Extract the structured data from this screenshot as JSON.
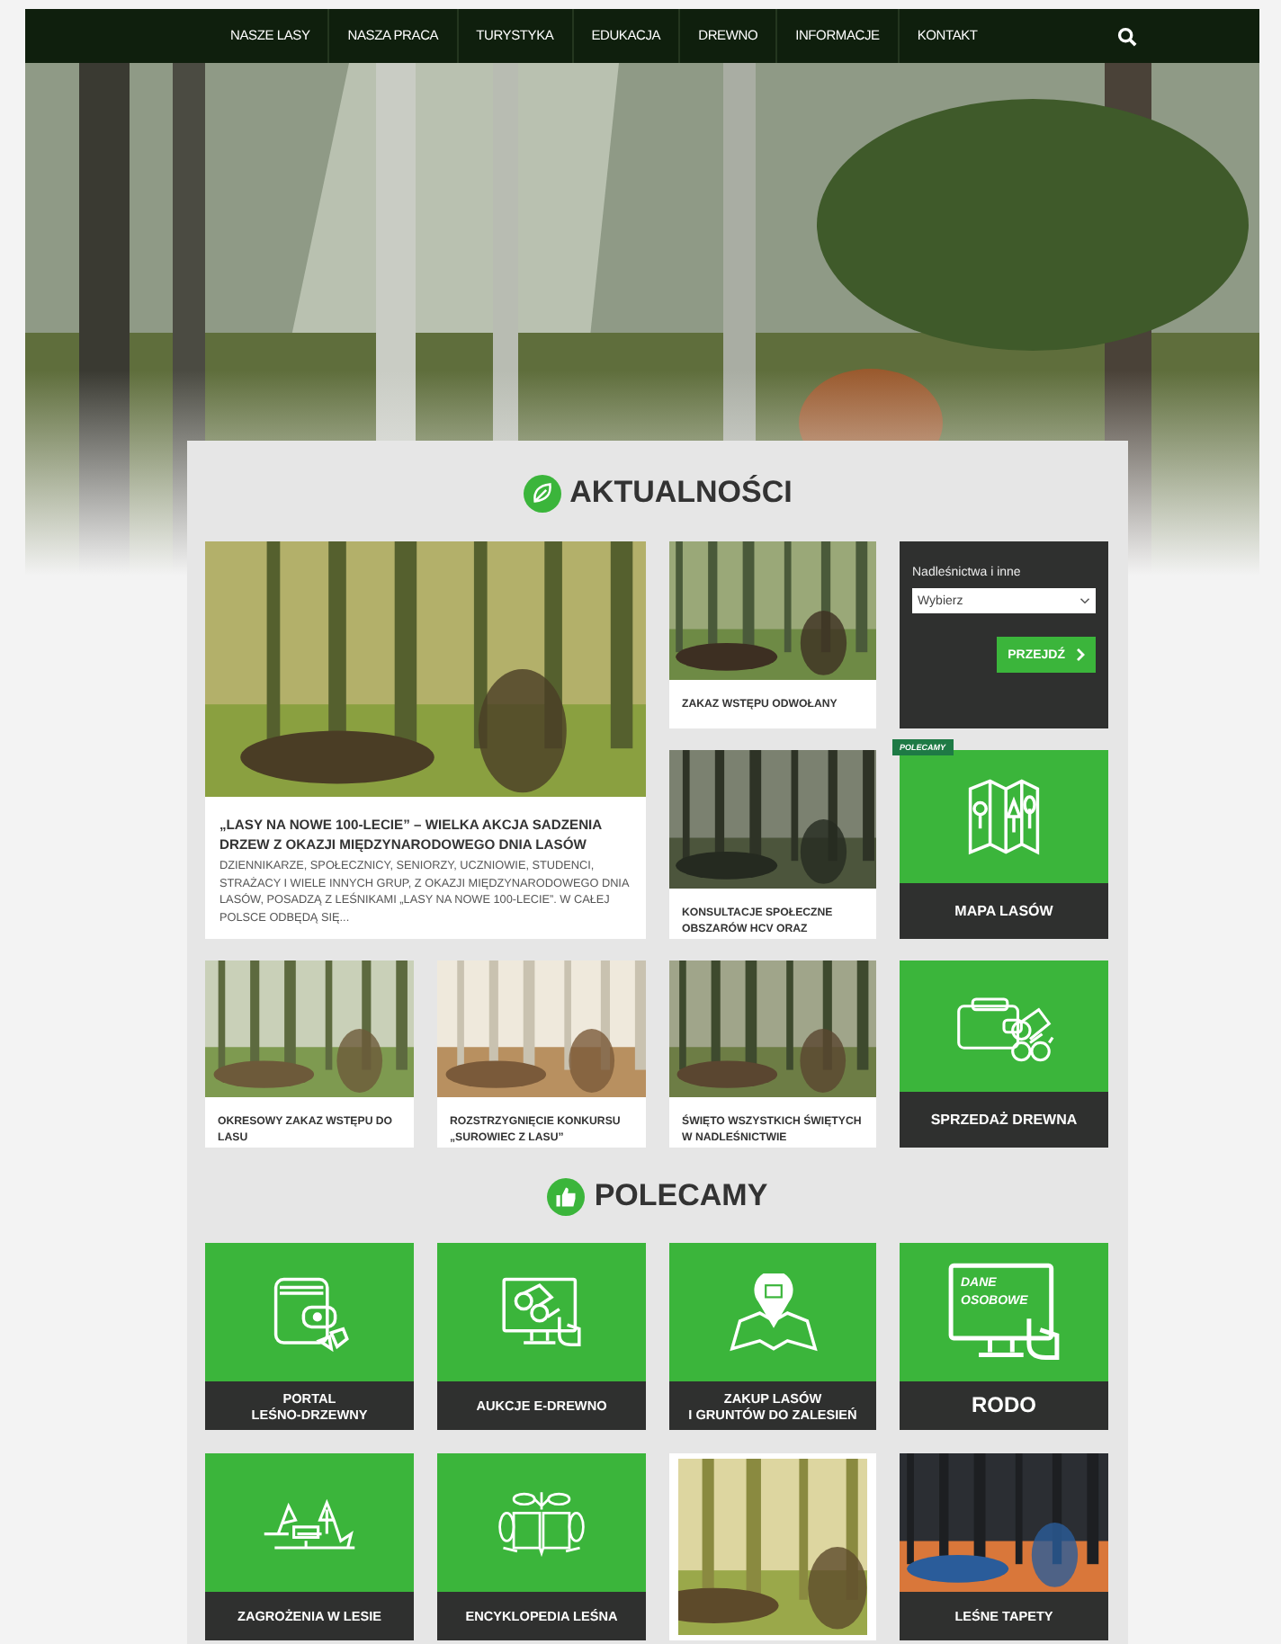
{
  "nav": {
    "items": [
      "NASZE LASY",
      "NASZA PRACA",
      "TURYSTYKA",
      "EDUKACJA",
      "DREWNO",
      "INFORMACJE",
      "KONTAKT"
    ]
  },
  "hero": {
    "kind": "picture"
  },
  "news": {
    "title": "AKTUALNOŚCI",
    "featured": {
      "title": "„LASY NA NOWE 100-LECIE” – WIELKA AKCJA SADZENIA DRZEW Z OKAZJI MIĘDZYNARODOWEGO DNIA LASÓW",
      "excerpt": "DZIENNIKARZE, SPOŁECZNICY, SENIORZY, UCZNIOWIE, STUDENCI, STRAŻACY I WIELE INNYCH GRUP, Z OKAZJI MIĘDZYNARODOWEGO DNIA LASÓW, POSADZĄ Z LEŚNIKAMI „LASY NA NOWE 100-LECIE”. W CAŁEJ POLSCE ODBĘDĄ SIĘ..."
    },
    "side_cards": [
      {
        "title": "ZAKAZ WSTĘPU ODWOŁANY"
      },
      {
        "title": "KONSULTACJE SPOŁECZNE OBSZARÓW HCV ORAZ"
      }
    ],
    "finder": {
      "label": "Nadleśnictwa i inne",
      "select": "Wybierz",
      "button": "PRZEJDŹ"
    },
    "map_tile": {
      "badge": "POLECAMY",
      "label": "MAPA LASÓW",
      "kind": "map"
    },
    "cards": [
      {
        "title": "OKRESOWY ZAKAZ WSTĘPU DO LASU"
      },
      {
        "title": "ROZSTRZYGNIĘCIE KONKURSU „SUROWIEC Z LASU”"
      },
      {
        "title": "ŚWIĘTO WSZYSTKICH ŚWIĘTYCH W NADLEŚNICTWIE"
      }
    ],
    "wood_tile": {
      "label": "SPRZEDAŻ DREWNA",
      "kind": "wood"
    }
  },
  "recommended": {
    "title": "POLECAMY",
    "tiles": [
      {
        "kind": "wallet",
        "label": "PORTAL\nLEŚNO-DRZEWNY"
      },
      {
        "kind": "auction",
        "label": "AUKCJE E-DREWNO"
      },
      {
        "kind": "pin",
        "label": "ZAKUP LASÓW\nI GRUNTÓW DO ZALESIEŃ"
      },
      {
        "kind": "screen",
        "screen_text": "DANE\nOSOBOWE",
        "label": "RODO"
      },
      {
        "kind": "stop",
        "label": "ZAGROŻENIA W LESIE"
      },
      {
        "kind": "book",
        "label": "ENCYKLOPEDIA LEŚNA"
      },
      {
        "kind": "picture"
      },
      {
        "kind": "picture",
        "label": "LEŚNE TAPETY"
      }
    ]
  }
}
